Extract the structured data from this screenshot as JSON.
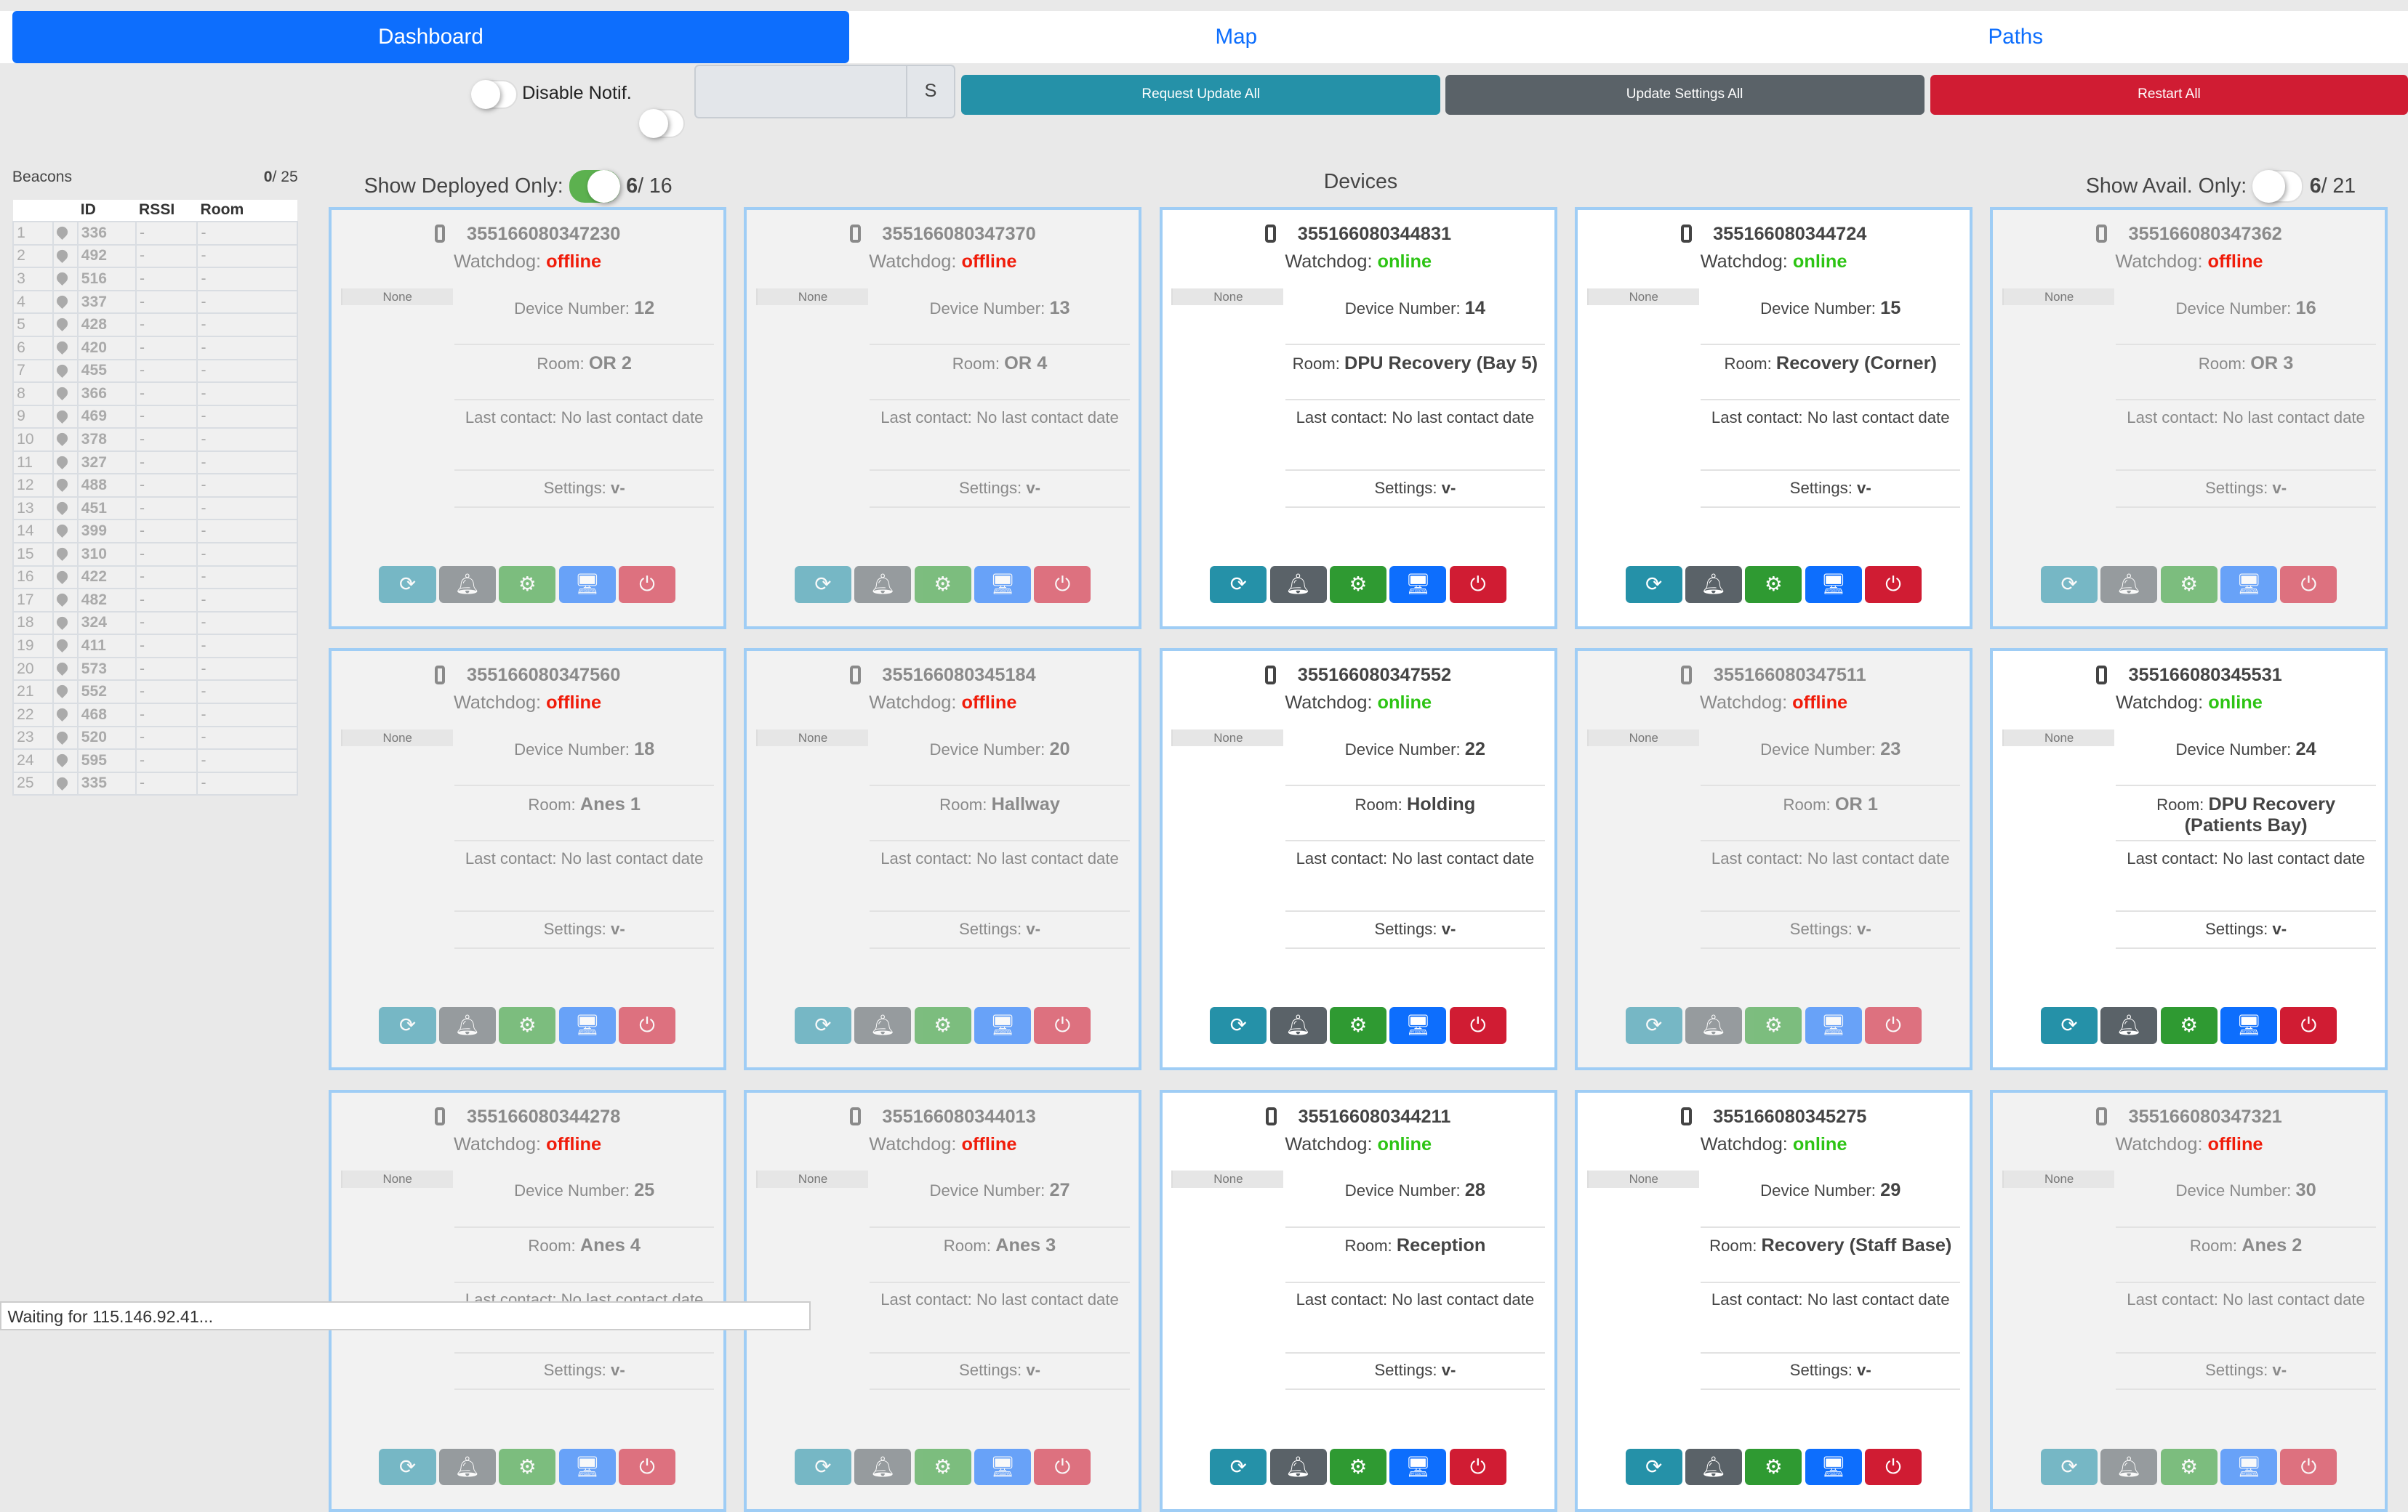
{
  "tabs": [
    {
      "label": "Dashboard",
      "active": true
    },
    {
      "label": "Map"
    },
    {
      "label": "Paths"
    }
  ],
  "toolbar": {
    "disable_notif_label": "Disable Notif.",
    "input_value": "",
    "input_addon": "S",
    "request_update_all": "Request Update All",
    "update_settings_all": "Update Settings All",
    "restart_all": "Restart All",
    "colors": {
      "request": "#2591a8",
      "settings": "#5a6268",
      "restart": "#d01c33"
    }
  },
  "beacons": {
    "title": "Beacons",
    "count_active": "0",
    "count_total": "/ 25",
    "columns": [
      "",
      "",
      "ID",
      "RSSI",
      "Room"
    ],
    "rows": [
      [
        "1",
        "336"
      ],
      [
        "2",
        "492"
      ],
      [
        "3",
        "516"
      ],
      [
        "4",
        "337"
      ],
      [
        "5",
        "428"
      ],
      [
        "6",
        "420"
      ],
      [
        "7",
        "455"
      ],
      [
        "8",
        "366"
      ],
      [
        "9",
        "469"
      ],
      [
        "10",
        "378"
      ],
      [
        "11",
        "327"
      ],
      [
        "12",
        "488"
      ],
      [
        "13",
        "451"
      ],
      [
        "14",
        "399"
      ],
      [
        "15",
        "310"
      ],
      [
        "16",
        "422"
      ],
      [
        "17",
        "482"
      ],
      [
        "18",
        "324"
      ],
      [
        "19",
        "411"
      ],
      [
        "20",
        "573"
      ],
      [
        "21",
        "552"
      ],
      [
        "22",
        "468"
      ],
      [
        "23",
        "520"
      ],
      [
        "24",
        "595"
      ],
      [
        "25",
        "335"
      ]
    ],
    "rssi": "-",
    "room": "-"
  },
  "devices_header": {
    "show_deployed_label": "Show Deployed Only:",
    "deployed_on": true,
    "deployed_count": "6",
    "deployed_total": "/ 16",
    "title": "Devices",
    "show_avail_label": "Show Avail. Only:",
    "avail_on": false,
    "avail_count": "6",
    "avail_total": "/ 21"
  },
  "card_labels": {
    "watchdog": "Watchdog: ",
    "device_number": "Device Number: ",
    "room": "Room: ",
    "last_contact": "Last contact: ",
    "settings": "Settings: ",
    "none": "None"
  },
  "status_colors": {
    "online": "#2dc414",
    "offline": "#f01c0a"
  },
  "devices": [
    {
      "imei": "355166080347230",
      "status": "offline",
      "number": "12",
      "room": "OR 2",
      "last_contact": "No last contact date",
      "settings": "v-"
    },
    {
      "imei": "355166080347370",
      "status": "offline",
      "number": "13",
      "room": "OR 4",
      "last_contact": "No last contact date",
      "settings": "v-"
    },
    {
      "imei": "355166080344831",
      "status": "online",
      "number": "14",
      "room": "DPU Recovery (Bay 5)",
      "last_contact": "No last contact date",
      "settings": "v-"
    },
    {
      "imei": "355166080344724",
      "status": "online",
      "number": "15",
      "room": "Recovery (Corner)",
      "last_contact": "No last contact date",
      "settings": "v-"
    },
    {
      "imei": "355166080347362",
      "status": "offline",
      "number": "16",
      "room": "OR 3",
      "last_contact": "No last contact date",
      "settings": "v-"
    },
    {
      "imei": "355166080347560",
      "status": "offline",
      "number": "18",
      "room": "Anes 1",
      "last_contact": "No last contact date",
      "settings": "v-"
    },
    {
      "imei": "355166080345184",
      "status": "offline",
      "number": "20",
      "room": "Hallway",
      "last_contact": "No last contact date",
      "settings": "v-"
    },
    {
      "imei": "355166080347552",
      "status": "online",
      "number": "22",
      "room": "Holding",
      "last_contact": "No last contact date",
      "settings": "v-"
    },
    {
      "imei": "355166080347511",
      "status": "offline",
      "number": "23",
      "room": "OR 1",
      "last_contact": "No last contact date",
      "settings": "v-"
    },
    {
      "imei": "355166080345531",
      "status": "online",
      "number": "24",
      "room": "DPU Recovery (Patients Bay)",
      "last_contact": "No last contact date",
      "settings": "v-"
    },
    {
      "imei": "355166080344278",
      "status": "offline",
      "number": "25",
      "room": "Anes 4",
      "last_contact": "No last contact date",
      "settings": "v-"
    },
    {
      "imei": "355166080344013",
      "status": "offline",
      "number": "27",
      "room": "Anes 3",
      "last_contact": "No last contact date",
      "settings": "v-"
    },
    {
      "imei": "355166080344211",
      "status": "online",
      "number": "28",
      "room": "Reception",
      "last_contact": "No last contact date",
      "settings": "v-"
    },
    {
      "imei": "355166080345275",
      "status": "online",
      "number": "29",
      "room": "Recovery (Staff Base)",
      "last_contact": "No last contact date",
      "settings": "v-"
    },
    {
      "imei": "355166080347321",
      "status": "offline",
      "number": "30",
      "room": "Anes 2",
      "last_contact": "No last contact date",
      "settings": "v-"
    }
  ],
  "card_actions": [
    {
      "icon": "refresh-icon",
      "glyph": "⟳",
      "color": "#2591a8"
    },
    {
      "icon": "bell-icon",
      "glyph": "🔔︎",
      "color": "#5a6268"
    },
    {
      "icon": "settings-sync-icon",
      "glyph": "⚙",
      "color": "#2f9a32"
    },
    {
      "icon": "remote-desktop-icon",
      "glyph": "🖥︎",
      "color": "#0d6efd"
    },
    {
      "icon": "power-icon",
      "glyph": "⏻",
      "color": "#d01c33"
    }
  ],
  "status_bar": "Waiting for 115.146.92.41..."
}
